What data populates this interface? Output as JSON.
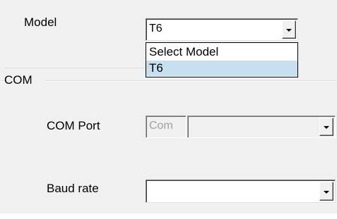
{
  "model": {
    "label": "Model",
    "selected": "T6",
    "options": [
      "Select Model",
      "T6"
    ],
    "highlighted_option": "T6",
    "dropdown_icon": "chevron-down-icon"
  },
  "com": {
    "group_label": "COM",
    "port_label": "COM Port",
    "port_prefix": "Com",
    "port_value": "",
    "baud_label": "Baud rate",
    "baud_value": ""
  },
  "colors": {
    "panel_bg": "#f0f0f0",
    "selection_bg": "#c7e0ef"
  }
}
